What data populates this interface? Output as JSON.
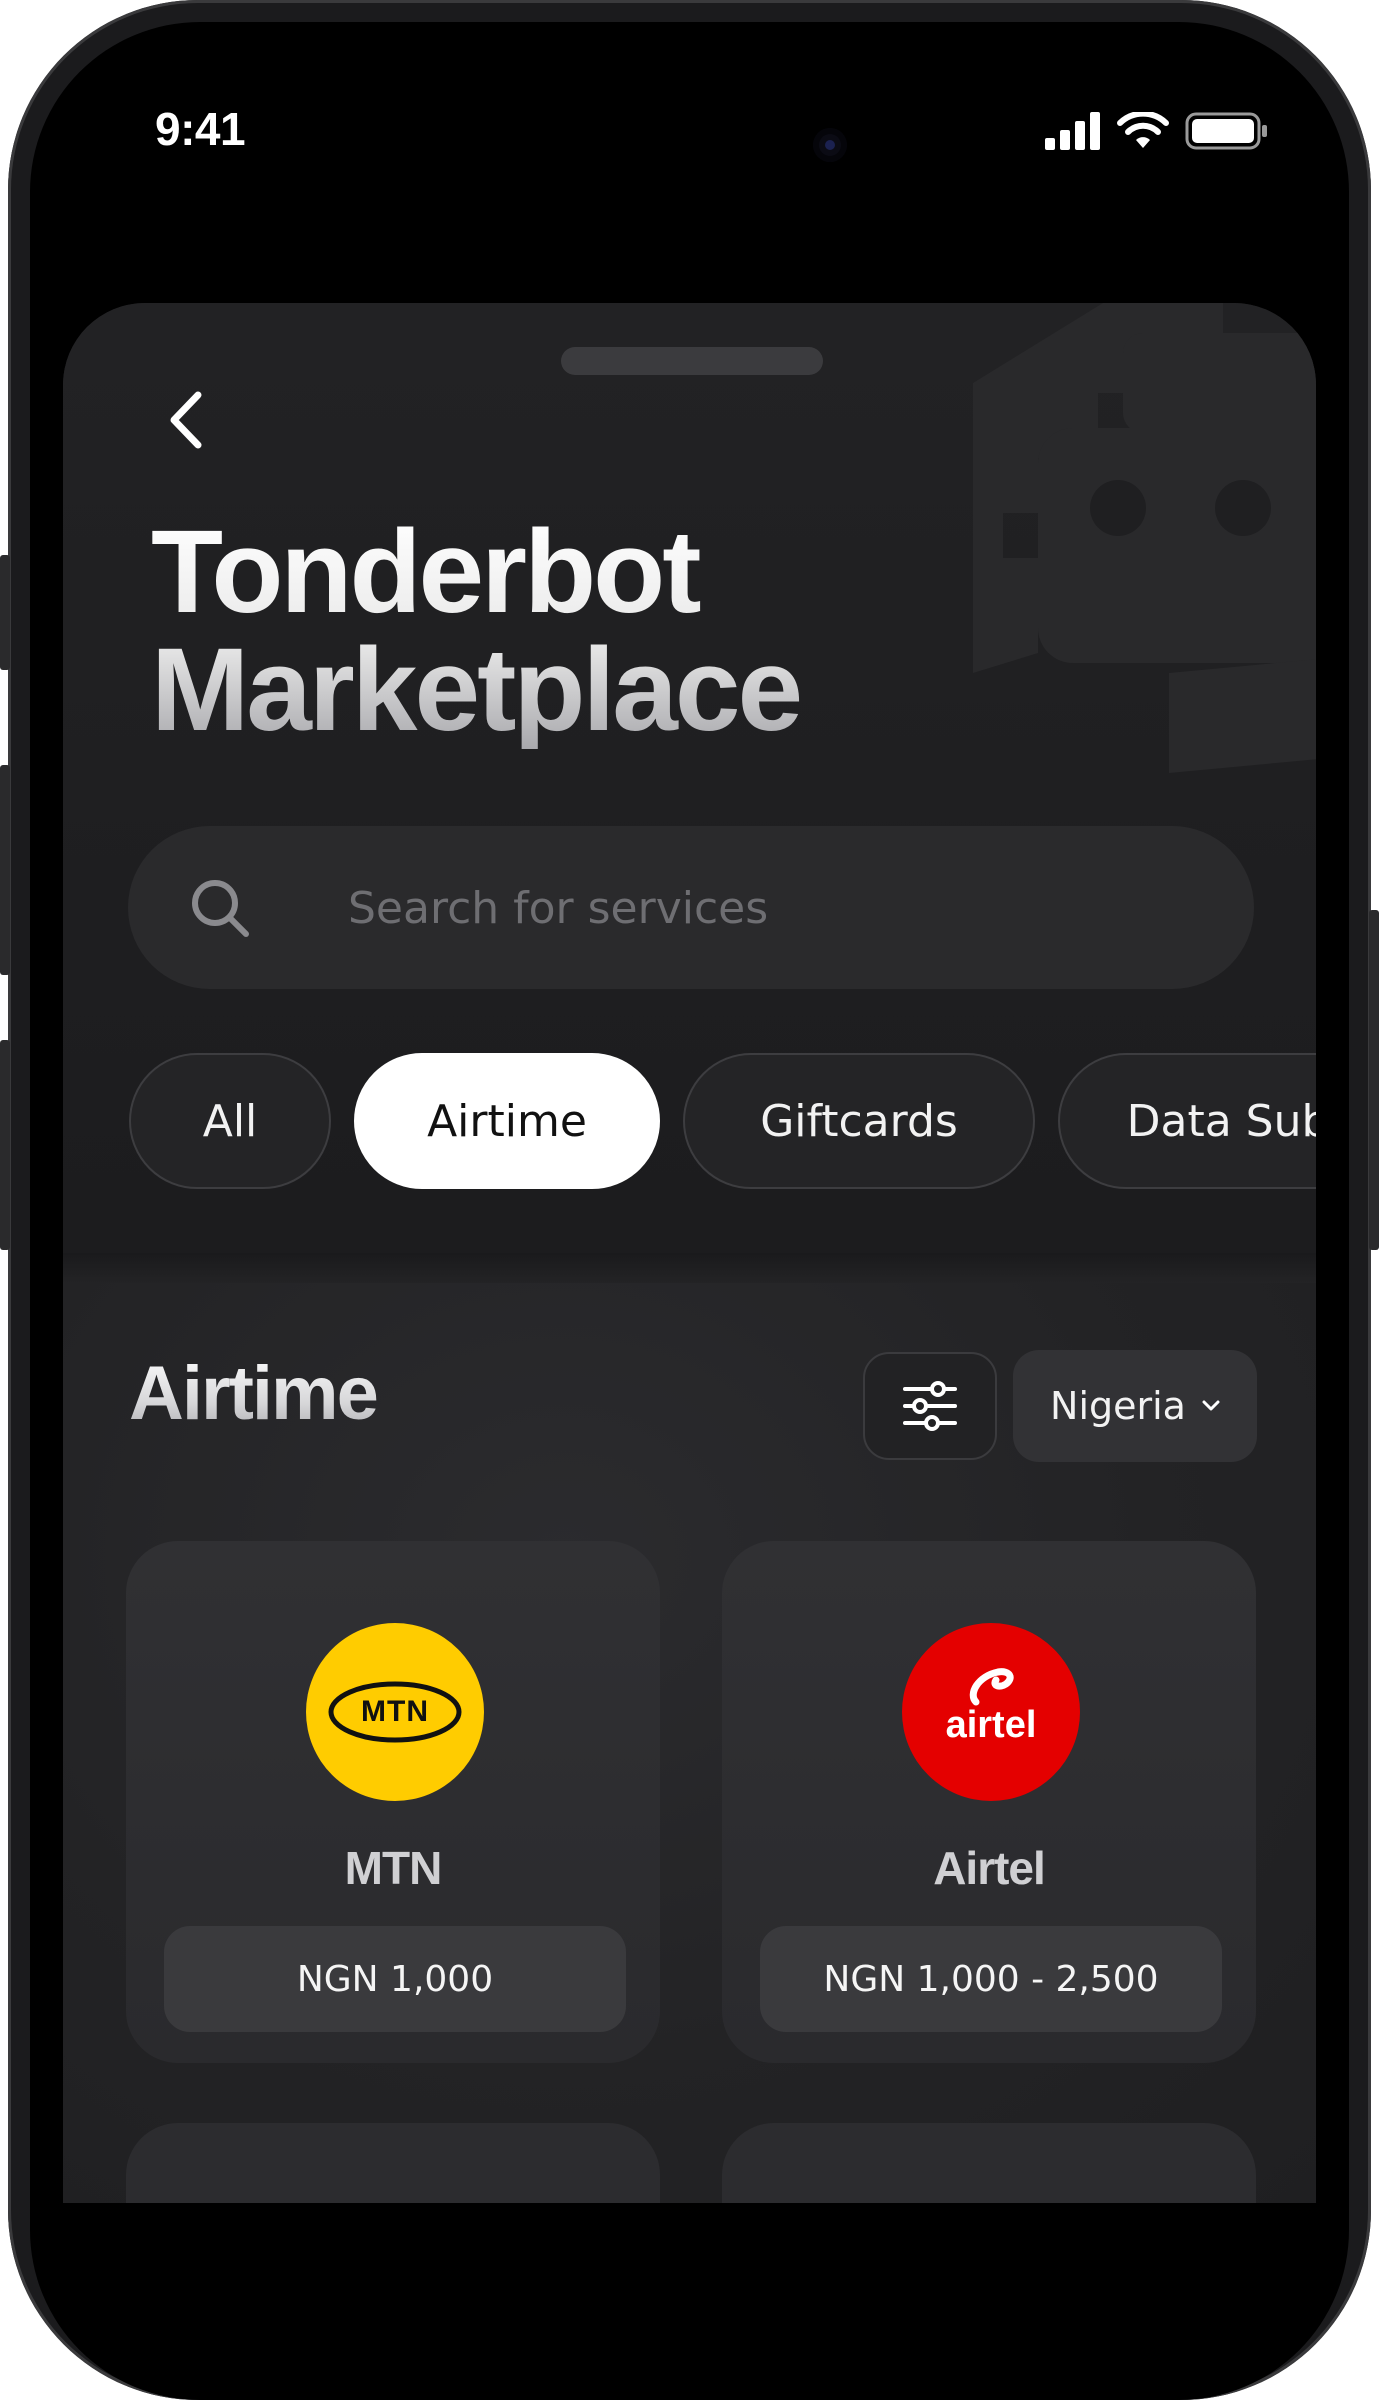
{
  "status_bar": {
    "time": "9:41"
  },
  "screen": {
    "title_line1": "Tonderbot",
    "title_line2": "Marketplace"
  },
  "search": {
    "placeholder": "Search for services",
    "value": ""
  },
  "categories": [
    {
      "label": "All",
      "active": false
    },
    {
      "label": "Airtime",
      "active": true
    },
    {
      "label": "Giftcards",
      "active": false
    },
    {
      "label": "Data Sub",
      "active": false
    }
  ],
  "section": {
    "title": "Airtime",
    "country": "Nigeria"
  },
  "providers": [
    {
      "name": "MTN",
      "logo_text": "MTN",
      "price": "NGN 1,000",
      "logo_color": "#ffcc00"
    },
    {
      "name": "Airtel",
      "logo_text": "airtel",
      "price": "NGN 1,000 - 2,500",
      "logo_color": "#e40000"
    }
  ],
  "icons": {
    "back": "chevron-left-icon",
    "search": "search-icon",
    "filter": "sliders-icon",
    "dropdown": "chevron-down-icon",
    "signal": "signal-icon",
    "wifi": "wifi-icon",
    "battery": "battery-icon"
  }
}
